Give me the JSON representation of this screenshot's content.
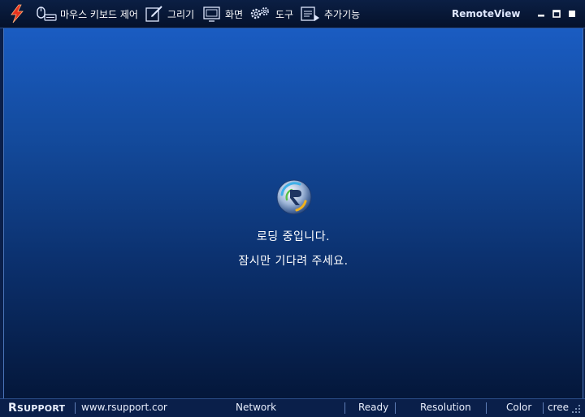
{
  "toolbar": {
    "mouse_keyboard": "마우스 키보드 제어",
    "draw": "그리기",
    "screen": "화면",
    "tools": "도구",
    "extras": "추가기능"
  },
  "app_title": "RemoteView",
  "loading": {
    "line1": "로딩 중입니다.",
    "line2": "잠시만 기다려 주세요."
  },
  "status": {
    "brand_r": "R",
    "brand_rest": "SUPPORT",
    "url": "www.rsupport.cor",
    "network": "Network",
    "ready": "Ready",
    "resolution": "Resolution",
    "color": "Color",
    "screen": "cree"
  },
  "colors": {
    "accent": "#1a5cc2",
    "bar": "#0a1f4a"
  }
}
